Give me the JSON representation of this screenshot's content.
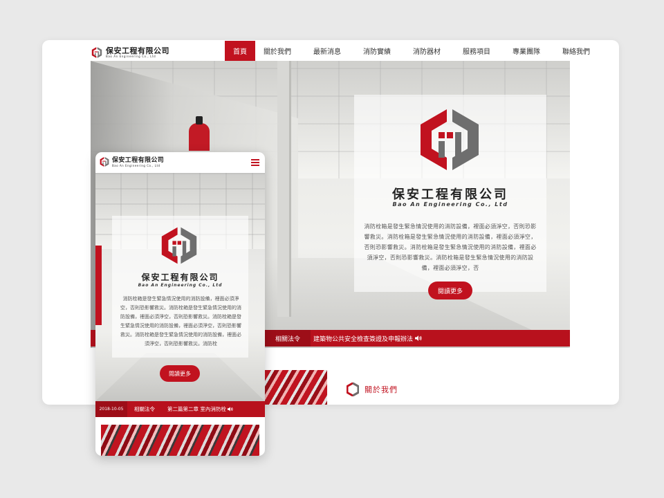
{
  "brand": {
    "name": "保安工程有限公司",
    "sub": "Bao An Engineering Co., Ltd",
    "colors": {
      "primary": "#c1121f",
      "dark": "#9d0e18",
      "grey": "#6b6b6b"
    }
  },
  "nav": {
    "items": [
      {
        "label": "首頁",
        "active": true
      },
      {
        "label": "關於我們"
      },
      {
        "label": "最新消息"
      },
      {
        "label": "消防實績"
      },
      {
        "label": "消防器材"
      },
      {
        "label": "服務項目"
      },
      {
        "label": "專業團隊"
      },
      {
        "label": "聯絡我們"
      }
    ]
  },
  "hero": {
    "title": "保安工程有限公司",
    "subtitle": "Bao An Engineering Co., Ltd",
    "description": "消防栓箱是發生緊急情況使用的消防設備，裡面必須淨空，否則恐影響救災。消防栓箱是發生緊急情況使用的消防設備，裡面必須淨空，否則恐影響救災。消防栓箱是發生緊急情況使用的消防設備，裡面必須淨空，否則恐影響救災。消防栓箱是發生緊急情況使用的消防設備，裡面必須淨空，否",
    "read_more": "閱讀更多"
  },
  "ticker": {
    "tag": "相關法令",
    "text": "建築物公共安全檢查簽證及申報辦法"
  },
  "about": {
    "title": "關於我們"
  },
  "mobile": {
    "description": "消防栓箱是發生緊急情況使用的消防設備，裡面必須淨空，否則恐影響救災。消防栓箱是發生緊急情況使用的消防設備，裡面必須淨空，否則恐影響救災。消防栓箱是發生緊急情況使用的消防設備，裡面必須淨空，否則恐影響救災。消防栓箱是發生緊急情況使用的消防設備，裡面必須淨空，否則恐影響救災。消防栓",
    "read_more": "閱讀更多",
    "ticker": {
      "date": "2018-10-05",
      "tag": "相關法令",
      "text": "第二篇第二章 室內消防栓"
    }
  },
  "icons": {
    "menu": "hamburger-icon",
    "speaker": "speaker-icon",
    "logo": "logo-mark-icon",
    "about": "hexagon-icon"
  }
}
